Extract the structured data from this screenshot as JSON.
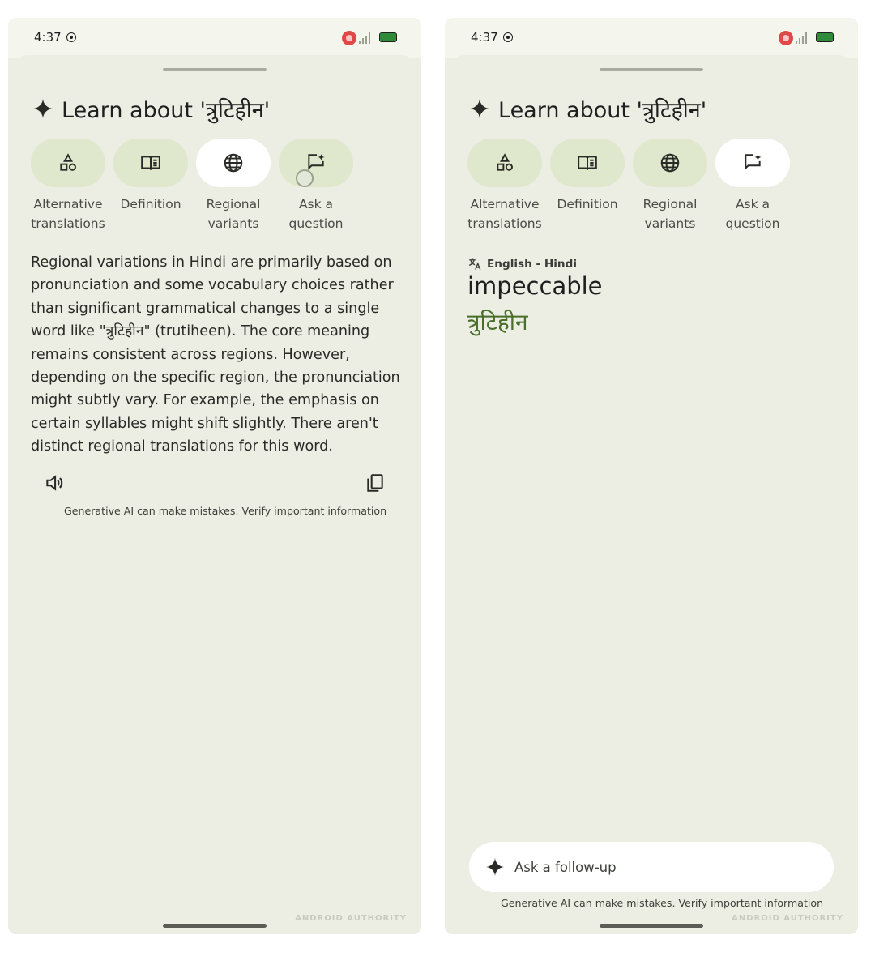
{
  "screens": [
    {
      "status": {
        "time": "4:37"
      },
      "title": "Learn about 'त्रुटिहीन'",
      "chips": [
        {
          "label": "Alternative translations",
          "icon": "shapes-icon",
          "active": false
        },
        {
          "label": "Definition",
          "icon": "book-icon",
          "active": false
        },
        {
          "label": "Regional variants",
          "icon": "globe-icon",
          "active": true
        },
        {
          "label": "Ask a question",
          "icon": "chat-spark-icon",
          "active": false
        }
      ],
      "body": "Regional variations in Hindi are primarily based on pronunciation and some vocabulary choices rather than significant grammatical changes to a single word like \"त्रुटिहीन\" (trutiheen).  The core meaning remains consistent across regions.  However, depending on the specific region, the pronunciation might subtly vary.  For example, the emphasis on certain syllables might shift slightly.  There aren't distinct regional translations for this word.",
      "disclaimer": "Generative AI can make mistakes. Verify important information",
      "watermark": "ANDROID AUTHORITY"
    },
    {
      "status": {
        "time": "4:37"
      },
      "title": "Learn about 'त्रुटिहीन'",
      "chips": [
        {
          "label": "Alternative translations",
          "icon": "shapes-icon",
          "active": false
        },
        {
          "label": "Definition",
          "icon": "book-icon",
          "active": false
        },
        {
          "label": "Regional variants",
          "icon": "globe-icon",
          "active": false
        },
        {
          "label": "Ask a question",
          "icon": "chat-spark-icon",
          "active": true
        }
      ],
      "language_pair": "English - Hindi",
      "source_word": "impeccable",
      "target_word": "त्रुटिहीन",
      "followup_placeholder": "Ask a follow-up",
      "disclaimer": "Generative AI can make mistakes. Verify important information",
      "watermark": "ANDROID AUTHORITY"
    }
  ],
  "colors": {
    "sheet_bg": "#ecede3",
    "chip_bg": "#dfe8cc",
    "chip_active_bg": "#ffffff",
    "hindi_word": "#4a6f2a"
  }
}
